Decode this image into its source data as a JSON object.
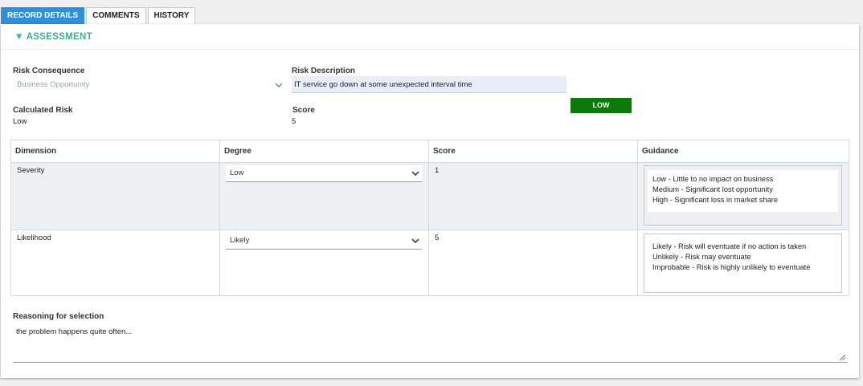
{
  "tabs": [
    {
      "label": "RECORD DETAILS",
      "active": true
    },
    {
      "label": "COMMENTS",
      "active": false
    },
    {
      "label": "HISTORY",
      "active": false
    }
  ],
  "section": {
    "title": "ASSESSMENT",
    "arrow": "▼"
  },
  "risk_consequence": {
    "label": "Risk Consequence",
    "value": "Business Opportunity"
  },
  "risk_description": {
    "label": "Risk Description",
    "value": "IT service go down at some unexpected interval time"
  },
  "calculated_risk": {
    "label": "Calculated Risk",
    "value": "Low"
  },
  "score": {
    "label": "Score",
    "value": "5"
  },
  "risk_badge": {
    "label": "LOW",
    "color": "#0b7a0b"
  },
  "table": {
    "headers": [
      "Dimension",
      "Degree",
      "Score",
      "Guidance"
    ],
    "rows": [
      {
        "dimension": "Severity",
        "degree": "Low",
        "score": "1",
        "guidance": [
          "Low - Little to no impact on business",
          "Medium - Significant lost opportunity",
          "High - Significant loss in market share"
        ]
      },
      {
        "dimension": "Likelihood",
        "degree": "Likely",
        "score": "5",
        "guidance": [
          "Likely - Risk will eventuate if no action is taken",
          "Unlikely - Risk may eventuate",
          "Improbable - Risk is highly unlikely to eventuate"
        ]
      }
    ]
  },
  "reasoning": {
    "label": "Reasoning for selection",
    "value": "the problem happens quite often..."
  },
  "colors": {
    "accent": "#2e8fde",
    "section_title": "#3fae8c",
    "badge": "#0b7a0b"
  },
  "icons": {
    "section_toggle": "collapse-arrow-icon",
    "dropdown": "chevron-down-icon",
    "resize": "resize-grip-icon"
  }
}
